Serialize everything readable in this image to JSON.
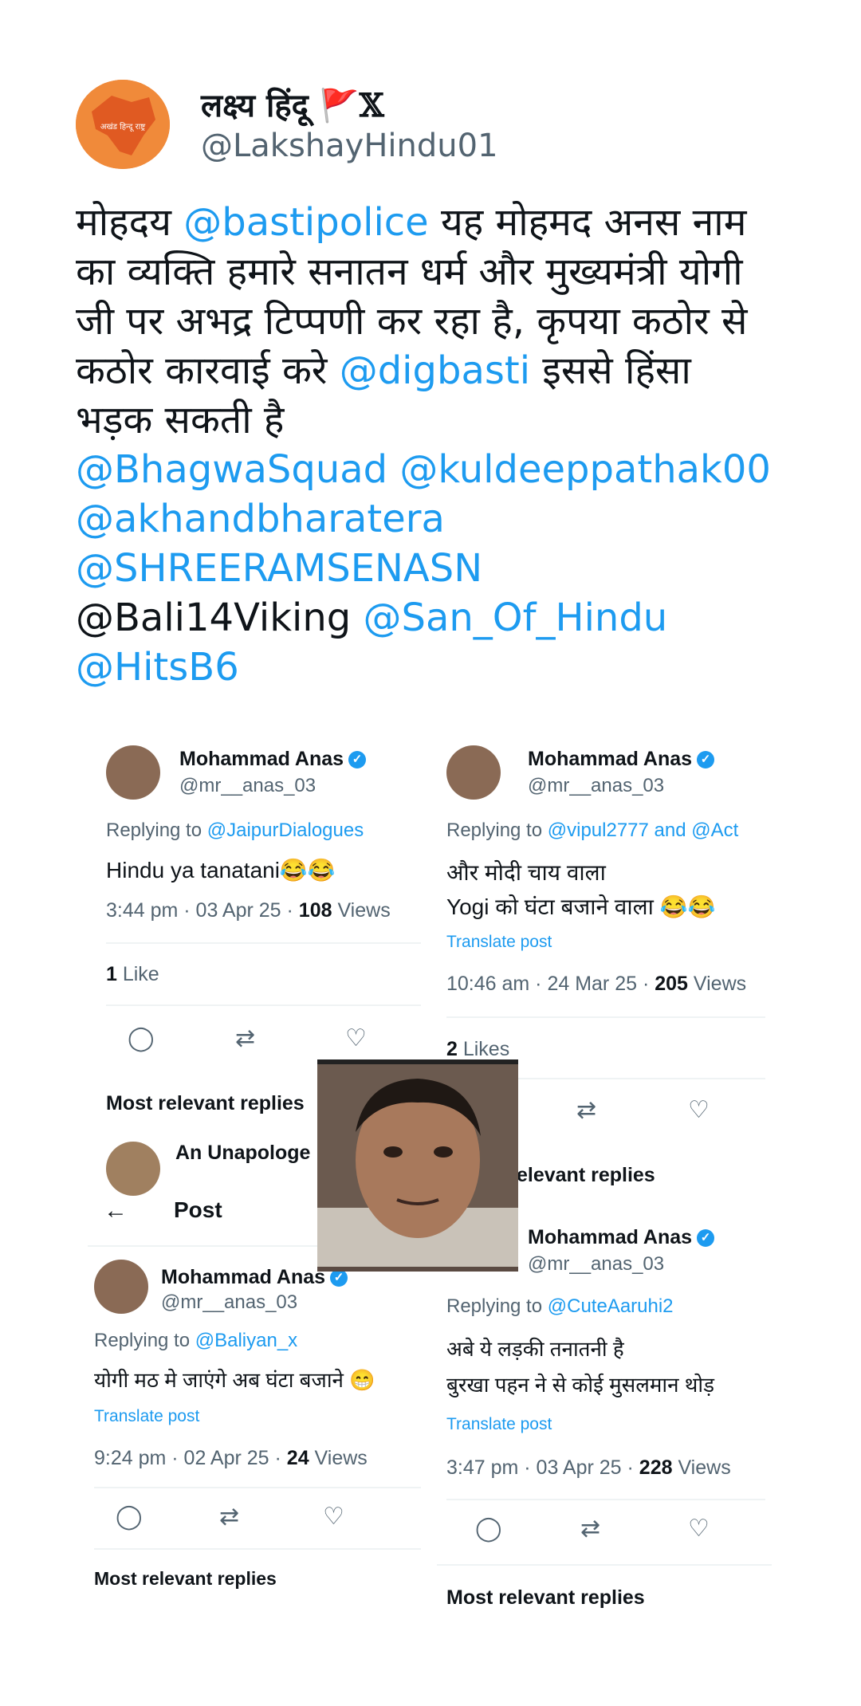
{
  "author": {
    "display_name": "लक्ष्य हिंदू",
    "handle": "@LakshayHindu01",
    "avatar_text": "अखंड हिन्दू राष्ट्र"
  },
  "tweet": {
    "lines": [
      [
        {
          "t": "मोहदय ",
          "link": false
        },
        {
          "t": "@bastipolice",
          "link": true
        },
        {
          "t": " यह मोहमद अनस नाम",
          "link": false
        }
      ],
      [
        {
          "t": "का व्यक्ति हमारे सनातन धर्म और मुख्यमंत्री योगी",
          "link": false
        }
      ],
      [
        {
          "t": "जी पर अभद्र टिप्पणी कर रहा है, कृपया कठोर से",
          "link": false
        }
      ],
      [
        {
          "t": "कठोर कारवाई करे ",
          "link": false
        },
        {
          "t": "@digbasti",
          "link": true
        },
        {
          "t": " इससे हिंसा",
          "link": false
        }
      ],
      [
        {
          "t": "भड़क सकती है",
          "link": false
        }
      ],
      [
        {
          "t": "@BhagwaSquad",
          "link": true
        },
        {
          "t": " ",
          "link": false
        },
        {
          "t": "@kuldeeppathak00",
          "link": true
        }
      ],
      [
        {
          "t": "@akhandbharatera",
          "link": true
        }
      ],
      [
        {
          "t": "@SHREERAMSENASN",
          "link": true
        }
      ],
      [
        {
          "t": "@Bali14Viking ",
          "link": false
        },
        {
          "t": "@San_Of_Hindu",
          "link": true
        }
      ],
      [
        {
          "t": "@HitsB6",
          "link": true
        }
      ]
    ]
  },
  "shots": {
    "name": "Mohammad Anas",
    "handle": "@mr__anas_03",
    "s1": {
      "reply_prefix": "Replying to ",
      "reply_to": "@JaipurDialogues",
      "text": "Hindu ya tanatani😂😂",
      "time": "3:44 pm · 03 Apr 25 · ",
      "views_num": "108",
      "views_label": " Views",
      "likes_num": "1",
      "likes_label": " Like",
      "relevant": "Most relevant replies",
      "next_name": "An Unapologe"
    },
    "s2": {
      "reply_prefix": "Replying to ",
      "reply_to": "@vipul2777 and @Act",
      "text1": "और मोदी चाय वाला",
      "text2": "Yogi को घंटा बजाने वाला 😂😂",
      "translate": "Translate post",
      "time": "10:46 am · 24 Mar 25 · ",
      "views_num": "205",
      "views_label": " Views",
      "likes_num": "2",
      "likes_label": " Likes",
      "relevant": "elevant replies"
    },
    "s3": {
      "header": "Post",
      "reply_prefix": "Replying to ",
      "reply_to": "@Baliyan_x",
      "text": "योगी मठ मे जाएंगे अब घंटा बजाने 😁",
      "translate": "Translate post",
      "time": "9:24 pm · 02 Apr 25 · ",
      "views_num": "24",
      "views_label": " Views",
      "relevant": "Most relevant replies"
    },
    "s4": {
      "reply_prefix": "Replying to ",
      "reply_to": "@CuteAaruhi2",
      "text1": "अबे ये लड़की तनातनी है",
      "text2": "बुरखा पहन ने से कोई मुसलमान थोड़",
      "translate": "Translate post",
      "time": "3:47 pm · 03 Apr 25 · ",
      "views_num": "228",
      "views_label": " Views",
      "relevant": "Most relevant replies"
    }
  }
}
